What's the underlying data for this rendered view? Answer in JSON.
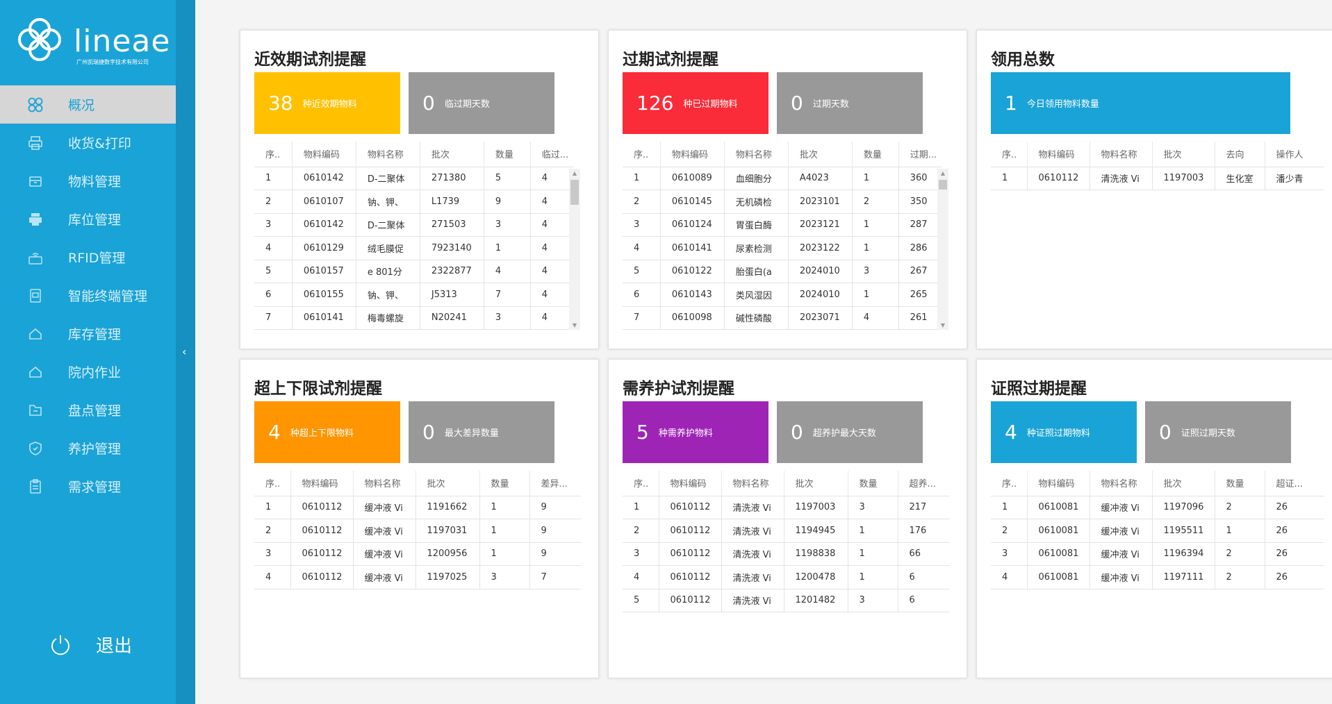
{
  "logo": {
    "name": "lineae",
    "subtitle": "广州凯瑞捷数字技术有限公司"
  },
  "sidebar": {
    "items": [
      {
        "label": "概况",
        "icon": "dashboard-icon",
        "active": true
      },
      {
        "label": "收货&打印",
        "icon": "printer-icon"
      },
      {
        "label": "物料管理",
        "icon": "box-icon"
      },
      {
        "label": "库位管理",
        "icon": "printer-solid-icon"
      },
      {
        "label": "RFID管理",
        "icon": "rfid-icon"
      },
      {
        "label": "智能终端管理",
        "icon": "terminal-icon"
      },
      {
        "label": "库存管理",
        "icon": "home-icon"
      },
      {
        "label": "院内作业",
        "icon": "home-icon"
      },
      {
        "label": "盘点管理",
        "icon": "folder-icon"
      },
      {
        "label": "养护管理",
        "icon": "shield-icon"
      },
      {
        "label": "需求管理",
        "icon": "clipboard-icon"
      }
    ],
    "logout": "退出"
  },
  "colors": {
    "sidebar": "#1aa3d6",
    "yellow": "#ffc000",
    "red": "#fa2c39",
    "blue": "#1aa3d6",
    "orange": "#ff9500",
    "purple": "#9e24b6",
    "gray": "#999999"
  },
  "cards": {
    "near_expiry": {
      "title": "近效期试剂提醒",
      "stat1": {
        "num": "38",
        "label": "种近效期物料"
      },
      "stat2": {
        "num": "0",
        "label": "临过期天数"
      },
      "headers": [
        "序..",
        "物料编码",
        "物料名称",
        "批次",
        "数量",
        "临过..."
      ],
      "rows": [
        [
          "1",
          "0610142",
          "D-二聚体",
          "271380",
          "5",
          "4"
        ],
        [
          "2",
          "0610107",
          "钠、钾、",
          "L1739",
          "9",
          "4"
        ],
        [
          "3",
          "0610142",
          "D-二聚体",
          "271503",
          "3",
          "4"
        ],
        [
          "4",
          "0610129",
          "绒毛膜促",
          "7923140",
          "1",
          "4"
        ],
        [
          "5",
          "0610157",
          "e 801分",
          "2322877",
          "4",
          "4"
        ],
        [
          "6",
          "0610155",
          "钠、钾、",
          "J5313",
          "7",
          "4"
        ],
        [
          "7",
          "0610141",
          "梅毒螺旋",
          "N20241",
          "3",
          "4"
        ]
      ]
    },
    "expired": {
      "title": "过期试剂提醒",
      "stat1": {
        "num": "126",
        "label": "种已过期物料"
      },
      "stat2": {
        "num": "0",
        "label": "过期天数"
      },
      "headers": [
        "序..",
        "物料编码",
        "物料名称",
        "批次",
        "数量",
        "过期..."
      ],
      "rows": [
        [
          "1",
          "0610089",
          "血细胞分",
          "A4023",
          "1",
          "360"
        ],
        [
          "2",
          "0610145",
          "无机磷检",
          "2023101",
          "2",
          "350"
        ],
        [
          "3",
          "0610124",
          "胃蛋白酶",
          "2023121",
          "1",
          "287"
        ],
        [
          "4",
          "0610141",
          "尿素检测",
          "2023122",
          "1",
          "286"
        ],
        [
          "5",
          "0610122",
          "胎蛋白(a",
          "2024010",
          "3",
          "267"
        ],
        [
          "6",
          "0610143",
          "类风湿因",
          "2024010",
          "1",
          "265"
        ],
        [
          "7",
          "0610098",
          "碱性磷酸",
          "2023071",
          "4",
          "261"
        ]
      ]
    },
    "usage": {
      "title": "领用总数",
      "stat1": {
        "num": "1",
        "label": "今日领用物料数量"
      },
      "headers": [
        "序..",
        "物料编码",
        "物料名称",
        "批次",
        "去向",
        "操作人"
      ],
      "rows": [
        [
          "1",
          "0610112",
          "清洗液 Vi",
          "1197003",
          "生化室",
          "潘少青"
        ]
      ]
    },
    "limits": {
      "title": "超上下限试剂提醒",
      "stat1": {
        "num": "4",
        "label": "种超上下限物料"
      },
      "stat2": {
        "num": "0",
        "label": "最大差异数量"
      },
      "headers": [
        "序..",
        "物料编码",
        "物料名称",
        "批次",
        "数量",
        "差异..."
      ],
      "rows": [
        [
          "1",
          "0610112",
          "缓冲液 Vi",
          "1191662",
          "1",
          "9"
        ],
        [
          "2",
          "0610112",
          "缓冲液 Vi",
          "1197031",
          "1",
          "9"
        ],
        [
          "3",
          "0610112",
          "缓冲液 Vi",
          "1200956",
          "1",
          "9"
        ],
        [
          "4",
          "0610112",
          "缓冲液 Vi",
          "1197025",
          "3",
          "7"
        ]
      ]
    },
    "maintenance": {
      "title": "需养护试剂提醒",
      "stat1": {
        "num": "5",
        "label": "种需养护物料"
      },
      "stat2": {
        "num": "0",
        "label": "超养护最大天数"
      },
      "headers": [
        "序..",
        "物料编码",
        "物料名称",
        "批次",
        "数量",
        "超养..."
      ],
      "rows": [
        [
          "1",
          "0610112",
          "清洗液 Vi",
          "1197003",
          "3",
          "217"
        ],
        [
          "2",
          "0610112",
          "清洗液 Vi",
          "1194945",
          "1",
          "176"
        ],
        [
          "3",
          "0610112",
          "清洗液 Vi",
          "1198838",
          "1",
          "66"
        ],
        [
          "4",
          "0610112",
          "清洗液 Vi",
          "1200478",
          "1",
          "6"
        ],
        [
          "5",
          "0610112",
          "清洗液 Vi",
          "1201482",
          "3",
          "6"
        ]
      ]
    },
    "license": {
      "title": "证照过期提醒",
      "stat1": {
        "num": "4",
        "label": "种证照过期物料"
      },
      "stat2": {
        "num": "0",
        "label": "证照过期天数"
      },
      "headers": [
        "序..",
        "物料编码",
        "物料名称",
        "批次",
        "数量",
        "超证..."
      ],
      "rows": [
        [
          "1",
          "0610081",
          "缓冲液 Vi",
          "1197096",
          "2",
          "26"
        ],
        [
          "2",
          "0610081",
          "缓冲液 Vi",
          "1195511",
          "1",
          "26"
        ],
        [
          "3",
          "0610081",
          "缓冲液 Vi",
          "1196394",
          "2",
          "26"
        ],
        [
          "4",
          "0610081",
          "缓冲液 Vi",
          "1197111",
          "2",
          "26"
        ]
      ]
    }
  }
}
